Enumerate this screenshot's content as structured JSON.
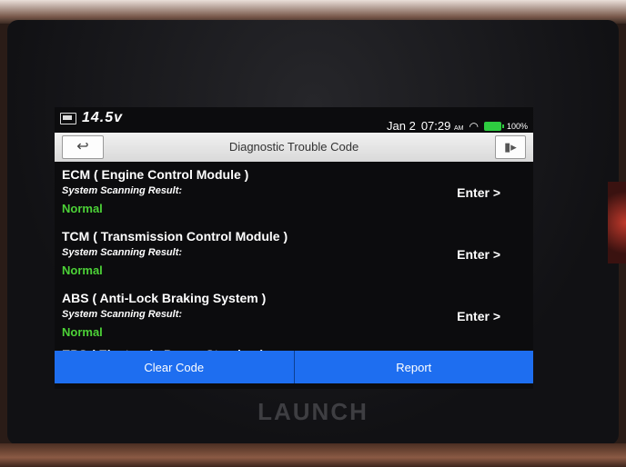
{
  "device": {
    "brand": "LAUNCH"
  },
  "status_bar": {
    "voltage": "14.5v",
    "date": "Jan 2",
    "time": "07:29",
    "ampm": "AM",
    "battery": "100%"
  },
  "header": {
    "title": "Diagnostic Trouble Code",
    "back_icon": "back-arrow-icon",
    "exit_icon": "exit-door-icon"
  },
  "modules": [
    {
      "name": "ECM ( Engine Control Module )",
      "result_label": "System Scanning Result:",
      "result": "Normal",
      "action": "Enter >"
    },
    {
      "name": "TCM ( Transmission Control Module )",
      "result_label": "System Scanning Result:",
      "result": "Normal",
      "action": "Enter >"
    },
    {
      "name": "ABS ( Anti-Lock Braking System )",
      "result_label": "System Scanning Result:",
      "result": "Normal",
      "action": "Enter >"
    },
    {
      "name": "EPS ( Electronic Power Steering )"
    }
  ],
  "footer": {
    "clear_label": "Clear Code",
    "report_label": "Report"
  },
  "colors": {
    "normal_status": "#4cd137",
    "button_blue": "#1e6ef0",
    "battery_green": "#2ecc40"
  }
}
